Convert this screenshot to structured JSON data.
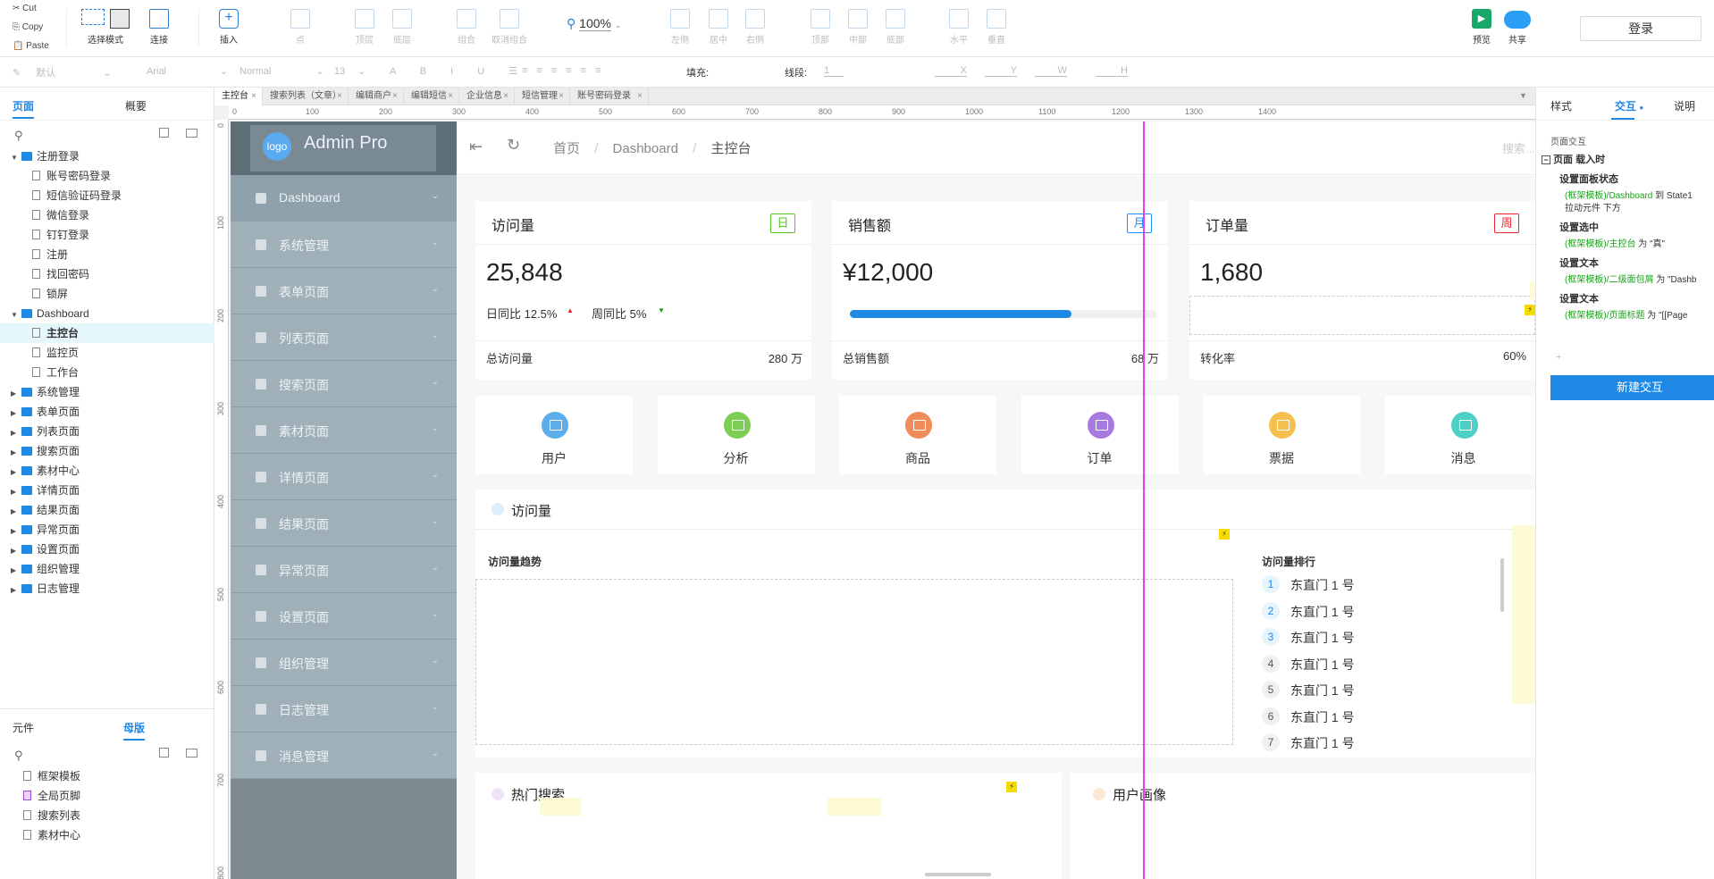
{
  "toolbar": {
    "clipboard": [
      "Cut",
      "Copy",
      "Paste"
    ],
    "select_mode": "选择模式",
    "connect": "连接",
    "insert": "插入",
    "point": "点",
    "top_layer": "顶层",
    "bottom_layer": "底层",
    "group": "组合",
    "ungroup": "取消组合",
    "zoom": "100%",
    "align_left": "左侧",
    "align_center": "居中",
    "align_right": "右侧",
    "align_top": "顶部",
    "align_middle": "中部",
    "align_bottom": "底部",
    "dist_h": "水平",
    "dist_v": "垂直",
    "preview": "预览",
    "share": "共享",
    "login": "登录"
  },
  "formatbar": {
    "style": "默认",
    "font": "Arial",
    "weight": "Normal",
    "size": "13",
    "fill_label": "填充:",
    "line_label": "线段:",
    "line_value": "1",
    "x": "X",
    "y": "Y",
    "w": "W",
    "h": "H"
  },
  "left_panel": {
    "tabs": [
      "页面",
      "概要"
    ],
    "tree": [
      {
        "label": "注册登录",
        "type": "folder",
        "level": 0,
        "open": true
      },
      {
        "label": "账号密码登录",
        "type": "page",
        "level": 1
      },
      {
        "label": "短信验证码登录",
        "type": "page",
        "level": 1
      },
      {
        "label": "微信登录",
        "type": "page",
        "level": 1
      },
      {
        "label": "钉钉登录",
        "type": "page",
        "level": 1
      },
      {
        "label": "注册",
        "type": "page",
        "level": 1
      },
      {
        "label": "找回密码",
        "type": "page",
        "level": 1
      },
      {
        "label": "锁屏",
        "type": "page",
        "level": 1
      },
      {
        "label": "Dashboard",
        "type": "folder",
        "level": 0,
        "open": true
      },
      {
        "label": "主控台",
        "type": "page",
        "level": 1,
        "selected": true
      },
      {
        "label": "监控页",
        "type": "page",
        "level": 1
      },
      {
        "label": "工作台",
        "type": "page",
        "level": 1
      },
      {
        "label": "系统管理",
        "type": "folder",
        "level": 0
      },
      {
        "label": "表单页面",
        "type": "folder",
        "level": 0
      },
      {
        "label": "列表页面",
        "type": "folder",
        "level": 0
      },
      {
        "label": "搜索页面",
        "type": "folder",
        "level": 0
      },
      {
        "label": "素材中心",
        "type": "folder",
        "level": 0
      },
      {
        "label": "详情页面",
        "type": "folder",
        "level": 0
      },
      {
        "label": "结果页面",
        "type": "folder",
        "level": 0
      },
      {
        "label": "异常页面",
        "type": "folder",
        "level": 0
      },
      {
        "label": "设置页面",
        "type": "folder",
        "level": 0
      },
      {
        "label": "组织管理",
        "type": "folder",
        "level": 0
      },
      {
        "label": "日志管理",
        "type": "folder",
        "level": 0
      }
    ],
    "bottom_tabs": [
      "元件",
      "母版"
    ],
    "masters": [
      "框架模板",
      "全局页脚",
      "搜索列表",
      "素材中心"
    ]
  },
  "doc_tabs": [
    "主控台",
    "搜索列表（文章）",
    "编辑商户",
    "编辑短信",
    "企业信息",
    "短信管理",
    "账号密码登录"
  ],
  "ruler_h": [
    "0",
    "100",
    "200",
    "300",
    "400",
    "500",
    "600",
    "700",
    "800",
    "900",
    "1000",
    "1100",
    "1200",
    "1300",
    "1400"
  ],
  "ruler_v": [
    "0",
    "100",
    "200",
    "300",
    "400",
    "500",
    "600",
    "700",
    "800"
  ],
  "design": {
    "logo": "logo",
    "app_name": "Admin Pro",
    "menu": [
      "Dashboard",
      "系统管理",
      "表单页面",
      "列表页面",
      "搜索页面",
      "素材页面",
      "详情页面",
      "结果页面",
      "异常页面",
      "设置页面",
      "组织管理",
      "日志管理",
      "消息管理"
    ],
    "breadcrumb": [
      "首页",
      "Dashboard",
      "主控台"
    ],
    "search_placeholder": "搜索...",
    "cards": [
      {
        "title": "访问量",
        "tag": "日",
        "tag_color": "#52c41a",
        "value": "25,848",
        "stat1": "日同比 12.5%",
        "stat2": "周同比 5%",
        "footer_label": "总访问量",
        "footer_value": "280 万"
      },
      {
        "title": "销售额",
        "tag": "月",
        "tag_color": "#1890ff",
        "value": "¥12,000",
        "progress": 0.72,
        "footer_label": "总销售额",
        "footer_value": "68 万"
      },
      {
        "title": "订单量",
        "tag": "周",
        "tag_color": "#f5222d",
        "value": "1,680",
        "footer_label": "转化率",
        "footer_value": "60%"
      }
    ],
    "quick": [
      {
        "label": "用户",
        "color": "#5dade8"
      },
      {
        "label": "分析",
        "color": "#7ccf52"
      },
      {
        "label": "商品",
        "color": "#f08c5a"
      },
      {
        "label": "订单",
        "color": "#a77ae0"
      },
      {
        "label": "票据",
        "color": "#f5c04e"
      },
      {
        "label": "消息",
        "color": "#4fd0c4"
      }
    ],
    "visits_section": "访问量",
    "trend_title": "访问量趋势",
    "ranking_title": "访问量排行",
    "ranking": [
      "东直门 1 号",
      "东直门 1 号",
      "东直门 1 号",
      "东直门 1 号",
      "东直门 1 号",
      "东直门 1 号",
      "东直门 1 号"
    ],
    "hot_search": "热门搜索",
    "user_profile": "用户画像"
  },
  "right_panel": {
    "tabs": [
      "样式",
      "交互",
      "说明"
    ],
    "section": "页面交互",
    "event": "页面 载入时",
    "actions": [
      {
        "title": "设置面板状态",
        "target": "(框架模板)/Dashboard",
        "detail": "到 State1",
        "extra": "拉动元件 下方"
      },
      {
        "title": "设置选中",
        "target": "(框架模板)/主控台",
        "detail": "为 \"真\""
      },
      {
        "title": "设置文本",
        "target": "(框架模板)/二级面包屑",
        "detail": "为 \"Dashb"
      },
      {
        "title": "设置文本",
        "target": "(框架模板)/页面标题",
        "detail": "为 \"[[Page"
      }
    ],
    "new_interaction": "新建交互"
  }
}
